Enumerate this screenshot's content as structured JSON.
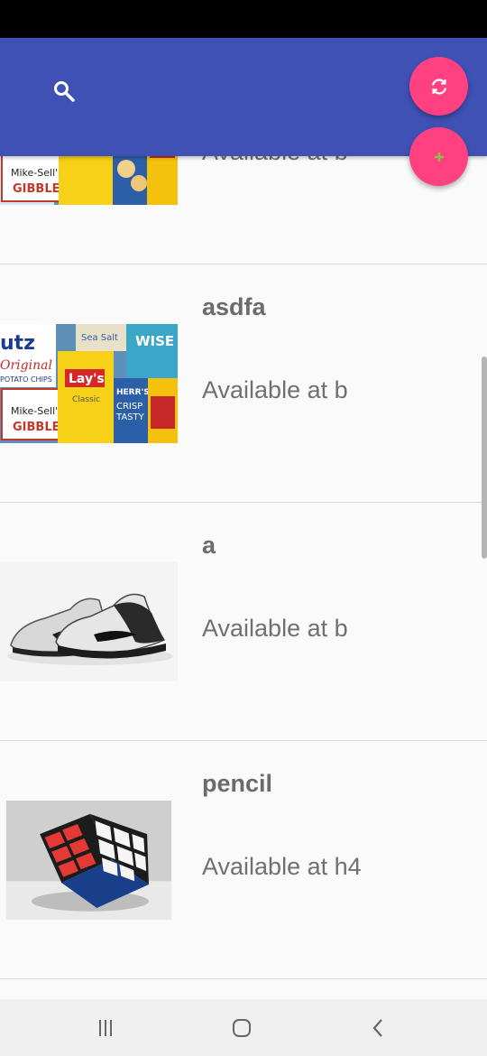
{
  "colors": {
    "app_bar": "#3f51b5",
    "fab": "#ff4081",
    "status_bar": "#000000",
    "nav_bar": "#f0f0f0"
  },
  "app_bar": {
    "icon": "search-icon"
  },
  "fabs": [
    {
      "icon": "refresh-icon"
    },
    {
      "icon": "plus-icon"
    }
  ],
  "items": [
    {
      "name": "",
      "availability": "Available at b",
      "image": "chips-image"
    },
    {
      "name": "asdfa",
      "availability": "Available at b",
      "image": "chips-image"
    },
    {
      "name": "a",
      "availability": "Available at b",
      "image": "sneakers-image"
    },
    {
      "name": "pencil",
      "availability": "Available at h4",
      "image": "rubiks-cube-image"
    }
  ],
  "nav_bar": {
    "buttons": [
      "recent-apps-icon",
      "home-icon",
      "back-icon"
    ]
  }
}
